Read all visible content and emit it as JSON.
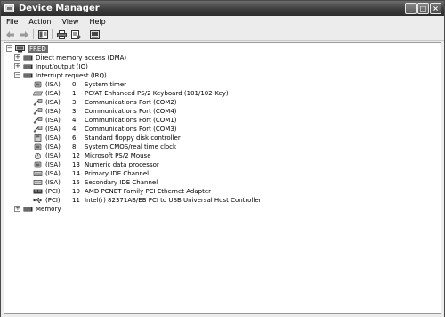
{
  "window": {
    "title": "Device Manager",
    "buttons": {
      "minimize": "_",
      "maximize": "□",
      "close": "×"
    }
  },
  "menubar": {
    "items": [
      "File",
      "Action",
      "View",
      "Help"
    ]
  },
  "toolbar": {
    "icons": [
      "back-arrow-icon",
      "forward-arrow-icon",
      "properties-pane-icon",
      "print-icon",
      "help-properties-icon",
      "computer-view-icon"
    ]
  },
  "tree": {
    "root": {
      "label": "FRED",
      "expander": "−"
    },
    "categories": [
      {
        "label": "Direct memory access (DMA)",
        "expander": "+"
      },
      {
        "label": "Input/output (IO)",
        "expander": "+"
      },
      {
        "label": "Interrupt request (IRQ)",
        "expander": "−"
      }
    ],
    "irq_items": [
      {
        "bus": "(ISA)",
        "irq": "0",
        "name": "System timer",
        "icon": "chip-icon"
      },
      {
        "bus": "(ISA)",
        "irq": "1",
        "name": "PC/AT Enhanced PS/2 Keyboard (101/102-Key)",
        "icon": "keyboard-icon"
      },
      {
        "bus": "(ISA)",
        "irq": "3",
        "name": "Communications Port (COM2)",
        "icon": "port-icon"
      },
      {
        "bus": "(ISA)",
        "irq": "3",
        "name": "Communications Port (COM4)",
        "icon": "port-icon"
      },
      {
        "bus": "(ISA)",
        "irq": "4",
        "name": "Communications Port (COM1)",
        "icon": "port-icon"
      },
      {
        "bus": "(ISA)",
        "irq": "4",
        "name": "Communications Port (COM3)",
        "icon": "port-icon"
      },
      {
        "bus": "(ISA)",
        "irq": "6",
        "name": "Standard floppy disk controller",
        "icon": "floppy-controller-icon"
      },
      {
        "bus": "(ISA)",
        "irq": "8",
        "name": "System CMOS/real time clock",
        "icon": "chip-icon"
      },
      {
        "bus": "(ISA)",
        "irq": "12",
        "name": "Microsoft PS/2 Mouse",
        "icon": "mouse-icon"
      },
      {
        "bus": "(ISA)",
        "irq": "13",
        "name": "Numeric data processor",
        "icon": "chip-icon"
      },
      {
        "bus": "(ISA)",
        "irq": "14",
        "name": "Primary IDE Channel",
        "icon": "ide-controller-icon"
      },
      {
        "bus": "(ISA)",
        "irq": "15",
        "name": "Secondary IDE Channel",
        "icon": "ide-controller-icon"
      },
      {
        "bus": "(PCI)",
        "irq": "10",
        "name": "AMD PCNET Family PCI Ethernet Adapter",
        "icon": "network-adapter-icon"
      },
      {
        "bus": "(PCI)",
        "irq": "11",
        "name": "Intel(r) 82371AB/EB PCI to USB Universal Host Controller",
        "icon": "usb-icon"
      }
    ],
    "last_category": {
      "label": "Memory",
      "expander": "+"
    }
  }
}
